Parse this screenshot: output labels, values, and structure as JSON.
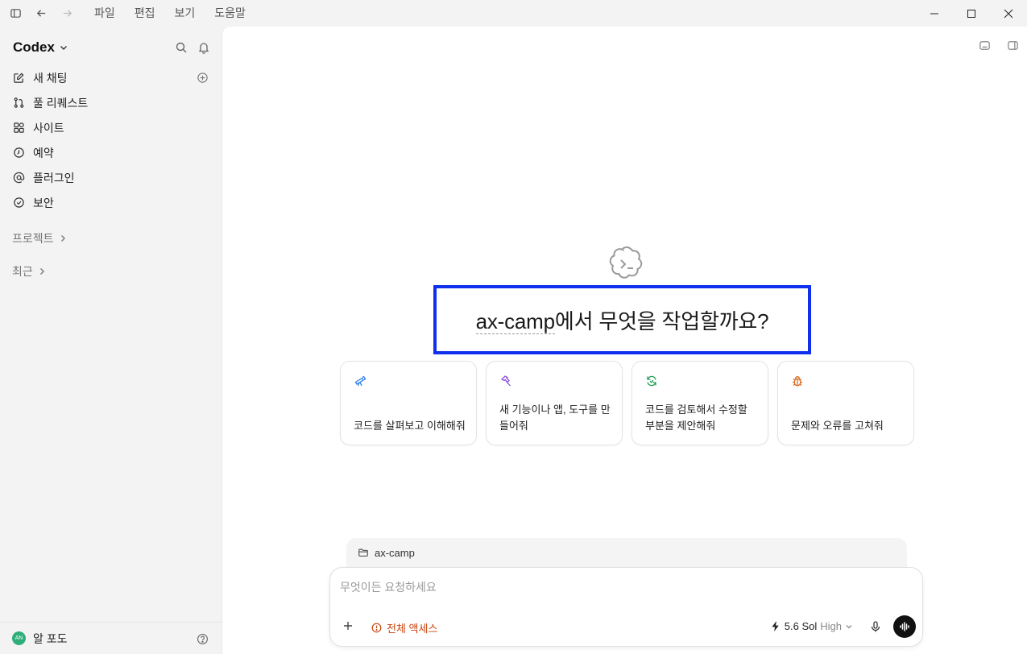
{
  "menu": {
    "items": [
      "파일",
      "편집",
      "보기",
      "도움말"
    ]
  },
  "sidebar": {
    "brand": "Codex",
    "nav": [
      {
        "label": "새 채팅",
        "icon": "edit-icon"
      },
      {
        "label": "풀 리퀘스트",
        "icon": "git-pull-request-icon"
      },
      {
        "label": "사이트",
        "icon": "apps-icon"
      },
      {
        "label": "예약",
        "icon": "clock-icon"
      },
      {
        "label": "플러그인",
        "icon": "at-sign-icon"
      },
      {
        "label": "보안",
        "icon": "shield-icon"
      }
    ],
    "projects_label": "프로젝트",
    "recent_label": "최근",
    "user": {
      "initials": "AN",
      "name": "알 포도"
    }
  },
  "main": {
    "headline_project": "ax-camp",
    "headline_rest": "에서 무엇을 작업할까요?",
    "cards": [
      {
        "text": "코드를 살펴보고 이해해줘",
        "icon": "telescope-icon",
        "color": "#2b7de9"
      },
      {
        "text": "새 기능이나 앱, 도구를 만들어줘",
        "icon": "hammer-icon",
        "color": "#8a4fd6"
      },
      {
        "text": "코드를 검토해서 수정할 부분을 제안해줘",
        "icon": "refresh-check-icon",
        "color": "#1e9e55"
      },
      {
        "text": "문제와 오류를 고쳐줘",
        "icon": "bug-icon",
        "color": "#d9691a"
      }
    ]
  },
  "composer": {
    "workspace": "ax-camp",
    "placeholder": "무엇이든 요청하세요",
    "access_label": "전체 액세스",
    "model": "5.6 Sol",
    "level": "High",
    "colors": {
      "access": "#c9440c"
    }
  }
}
